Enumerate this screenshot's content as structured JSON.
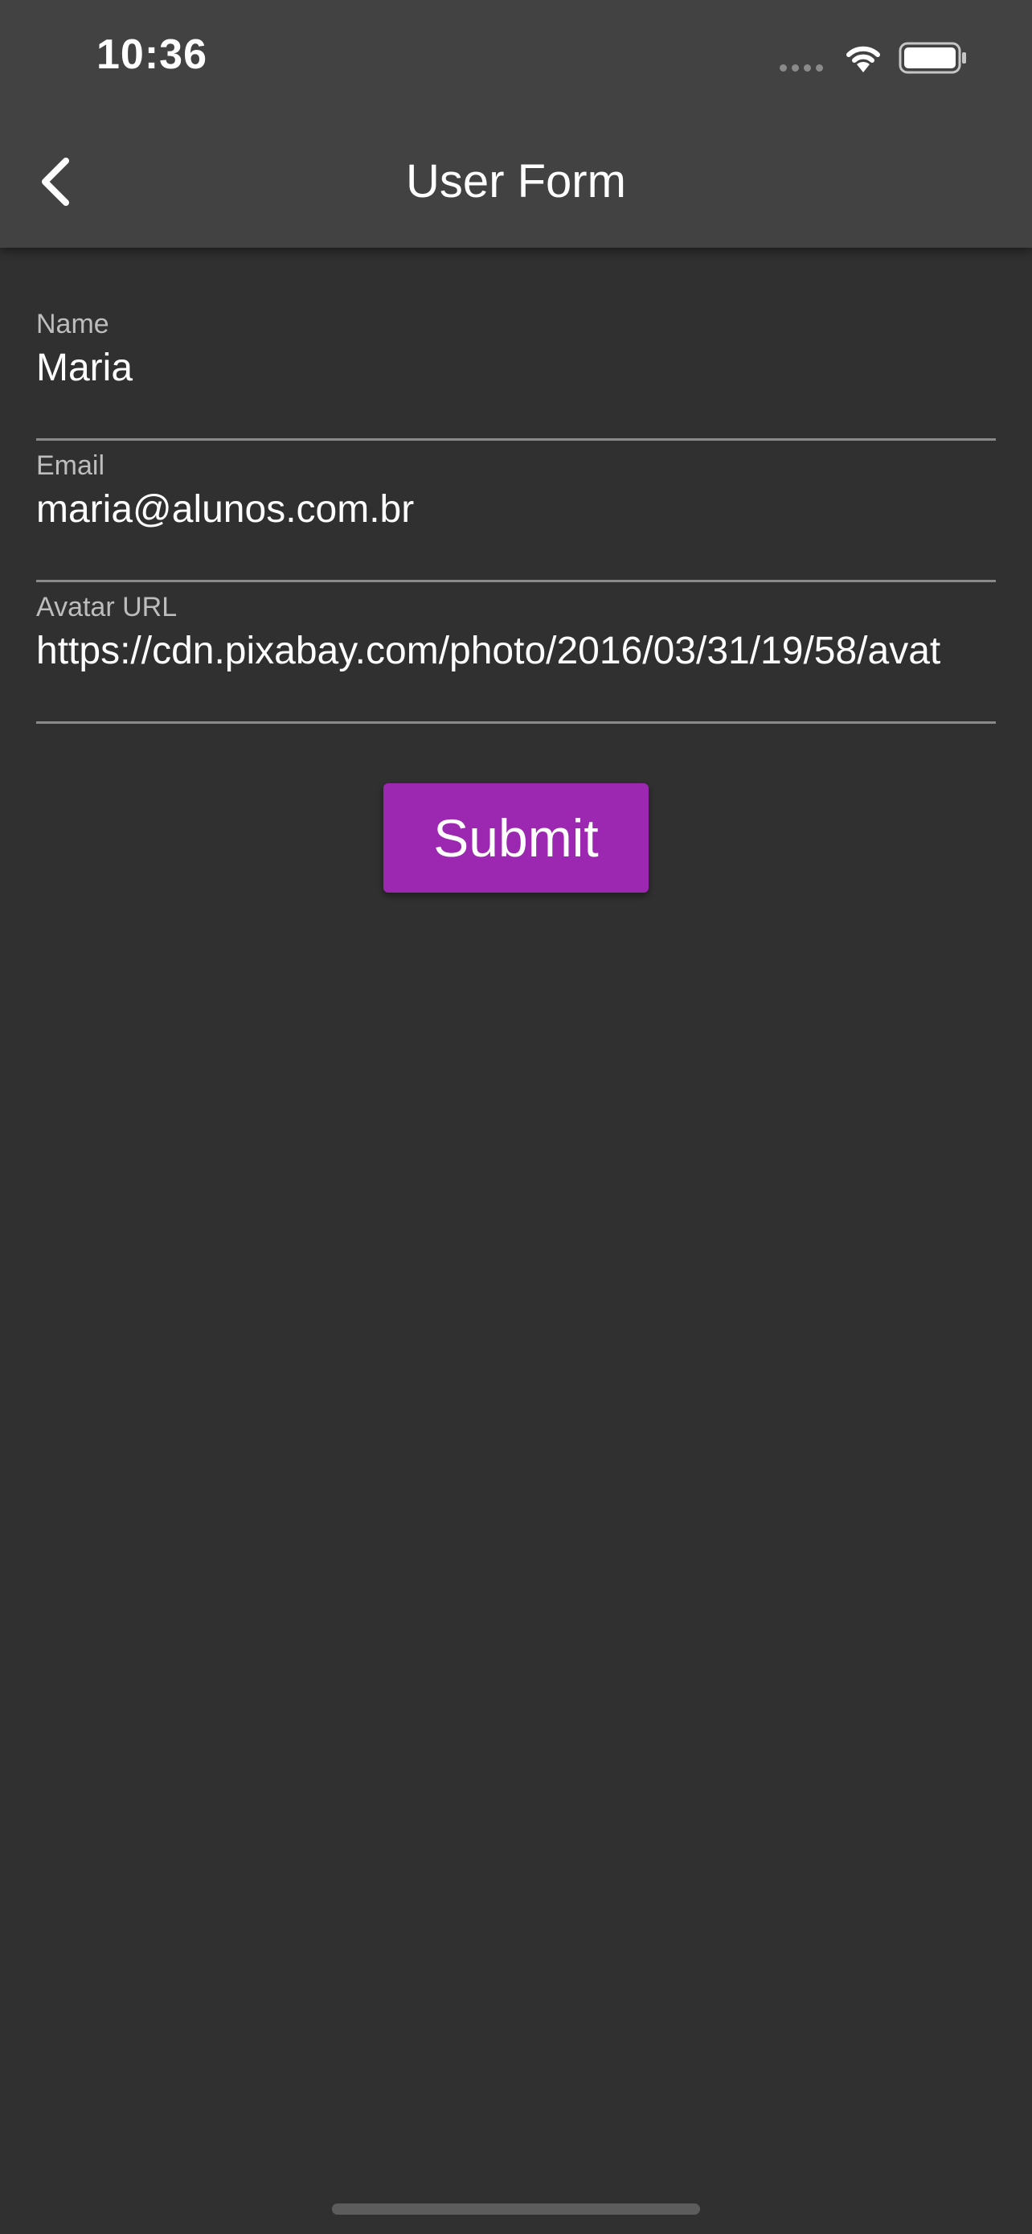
{
  "status_bar": {
    "time": "10:36"
  },
  "app_bar": {
    "title": "User Form",
    "back_icon": "chevron-left-icon"
  },
  "form": {
    "fields": [
      {
        "label": "Name",
        "value": "Maria"
      },
      {
        "label": "Email",
        "value": "maria@alunos.com.br"
      },
      {
        "label": "Avatar URL",
        "value": "https://cdn.pixabay.com/photo/2016/03/31/19/58/avat"
      }
    ],
    "submit_label": "Submit"
  },
  "colors": {
    "background": "#303030",
    "app_bar": "#424242",
    "accent": "#9c27b0",
    "divider": "#8a8a8a"
  }
}
